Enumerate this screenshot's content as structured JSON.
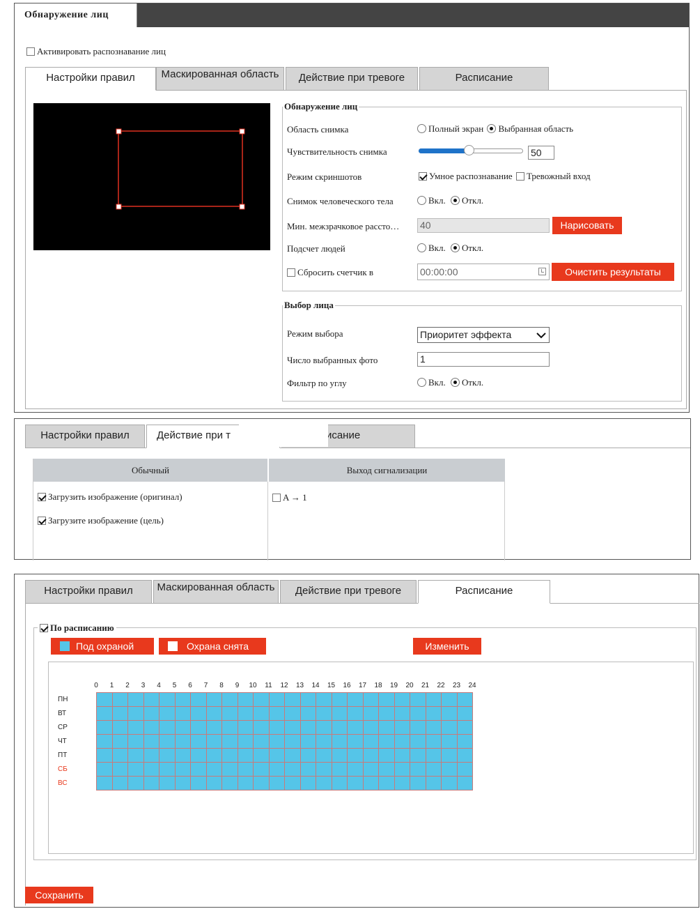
{
  "panel1": {
    "header_tab": "Обнаружение лиц",
    "activate_label": "Активировать распознавание лиц",
    "tabs": [
      "Настройки правил",
      "Маскированная область",
      "Действие при тревоге",
      "Расписание"
    ],
    "face_detection": {
      "legend": "Обнаружение лиц",
      "capture_area_label": "Область снимка",
      "capture_area_opt1": "Полный экран",
      "capture_area_opt2": "Выбранная область",
      "sensitivity_label": "Чувствительность снимка",
      "sensitivity_value": "50",
      "sensitivity_fraction": 0.48,
      "screenshot_mode_label": "Режим скриншотов",
      "smart_detection": "Умное распознавание",
      "alarm_input": "Тревожный вход",
      "body_capture_label": "Снимок человеческого тела",
      "on": "Вкл.",
      "off": "Откл.",
      "min_pupil_label": "Мин. межзрачковое рассто…",
      "min_pupil_value": "40",
      "draw_button": "Нарисовать",
      "people_count_label": "Подсчет людей",
      "reset_counter_label": "Сбросить счетчик в",
      "reset_time": "00:00:00",
      "clear_button": "Очистить результаты"
    },
    "face_selection": {
      "legend": "Выбор лица",
      "mode_label": "Режим выбора",
      "mode_value": "Приоритет эффекта",
      "count_label": "Число выбранных фото",
      "count_value": "1",
      "angle_filter_label": "Фильтр по углу",
      "on": "Вкл.",
      "off": "Откл."
    }
  },
  "panel2": {
    "tabs": [
      "Настройки правил",
      "Действие при т",
      "асписание"
    ],
    "col_normal": "Обычный",
    "col_alarm": "Выход сигнализации",
    "upload_original": "Загрузить изображение (оригинал)",
    "upload_target": "Загрузите изображение (цель)",
    "alarm_output": "A → 1"
  },
  "panel3": {
    "tabs": [
      "Настройки правил",
      "Маскированная область",
      "Действие при тревоге",
      "Расписание"
    ],
    "schedule_legend": "По расписанию",
    "armed_button": "Под охраной",
    "disarmed_button": "Охрана снята",
    "edit_button": "Изменить",
    "hours": [
      "0",
      "1",
      "2",
      "3",
      "4",
      "5",
      "6",
      "7",
      "8",
      "9",
      "10",
      "11",
      "12",
      "13",
      "14",
      "15",
      "16",
      "17",
      "18",
      "19",
      "20",
      "21",
      "22",
      "23",
      "24"
    ],
    "days": [
      "ПН",
      "ВТ",
      "СР",
      "ЧТ",
      "ПТ",
      "СБ",
      "ВС"
    ],
    "armed_color": "#55c5e8",
    "weekend_color": "#e8391d"
  },
  "save_button": "Сохранить"
}
